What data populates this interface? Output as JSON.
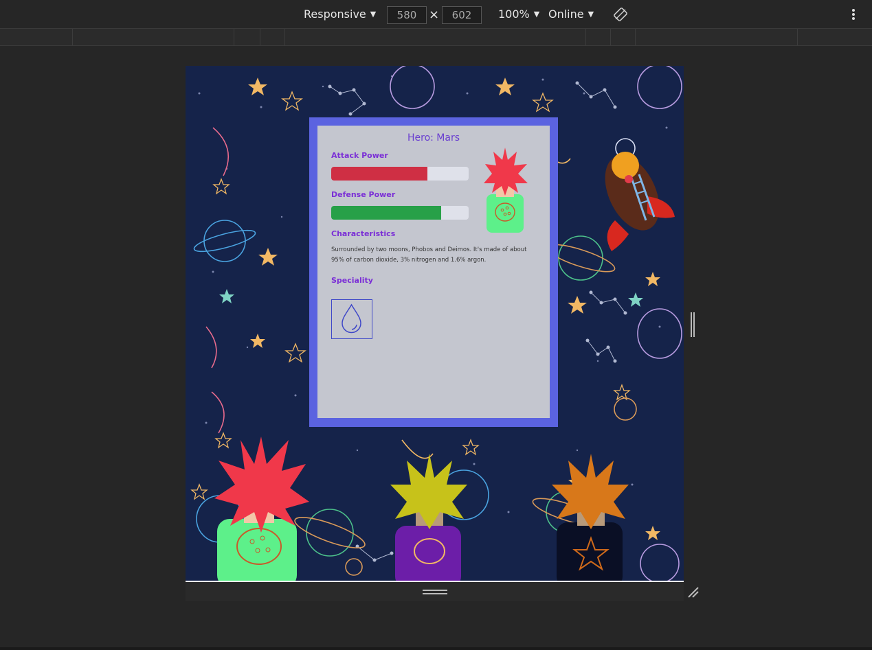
{
  "devtools": {
    "device": "Responsive",
    "width": "580",
    "height": "602",
    "times": "×",
    "zoom": "100%",
    "network": "Online"
  },
  "card": {
    "title": "Hero: Mars",
    "attack": {
      "label": "Attack Power",
      "value": 0.7,
      "color": "#cf2f44"
    },
    "defense": {
      "label": "Defense Power",
      "value": 0.8,
      "color": "#27a048"
    },
    "characteristics_label": "Characteristics",
    "characteristics_text": "Surrounded by two moons, Phobos and Deimos. It's made of about 95% of carbon dioxide, 3% nitrogen and 1.6% argon.",
    "speciality_label": "Speciality",
    "speciality_icon": "water-drop-icon"
  },
  "colors": {
    "frame": "#5b63e0",
    "card_bg": "#c4c6cf",
    "label": "#7b2fd6",
    "space_bg": "#15234a"
  }
}
